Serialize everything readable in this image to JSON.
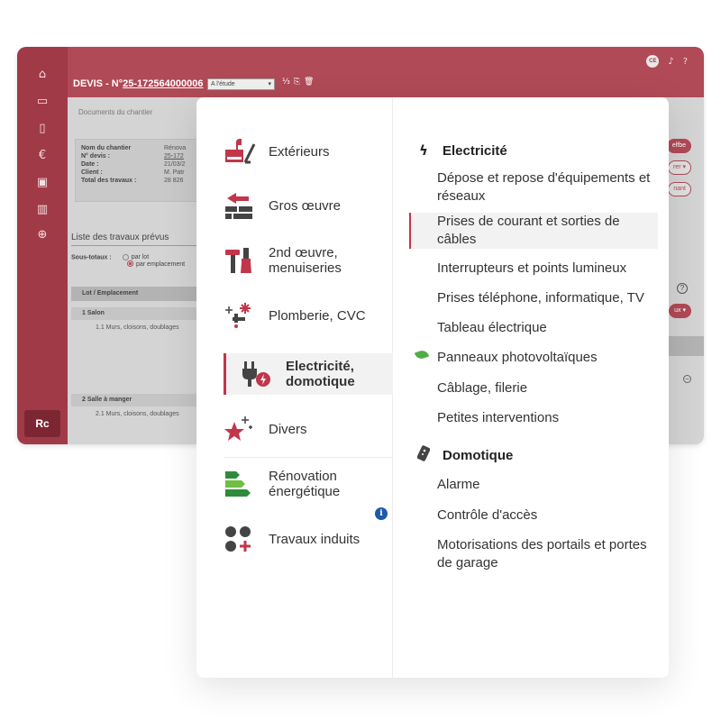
{
  "app": {
    "sidebar_icons": [
      "home-icon",
      "folder-open-icon",
      "file-icon",
      "euro-icon",
      "contact-card-icon",
      "library-icon",
      "globe-icon"
    ],
    "sidebar_bottom_logo": "Rc",
    "header": {
      "title_prefix": "DEVIS - N°",
      "quote_number": "25-172564000006",
      "status_select": "A l'étude",
      "avatar_initials": "CE"
    },
    "content": {
      "docs_tab": "Documents du chantier",
      "info": [
        {
          "key": "Nom du chantier",
          "value": "Rénova"
        },
        {
          "key": "N° devis :",
          "value": "25-172"
        },
        {
          "key": "Date :",
          "value": "21/03/2"
        },
        {
          "key": "Client :",
          "value": "M. Patr"
        },
        {
          "key": "Total des travaux :",
          "value": "28 826"
        }
      ],
      "list_title": "Liste des travaux prévus",
      "subtotals_label": "Sous-totaux :",
      "subtotal_options": [
        "par lot",
        "par emplacement"
      ],
      "table_header": "Lot / Emplacement",
      "groups": [
        {
          "label": "1   Salon",
          "sub": "1.1  Murs, cloisons, doublages"
        },
        {
          "label": "2   Salle à manger",
          "sub": "2.1  Murs, cloisons, doublages"
        }
      ],
      "right_pills": [
        "elfbe",
        "rer ▾",
        "nant",
        "ux ▾"
      ]
    }
  },
  "menu": {
    "categories": [
      {
        "label": "Extérieurs",
        "icon": "exterior-works-icon"
      },
      {
        "label": "Gros œuvre",
        "icon": "structural-works-icon"
      },
      {
        "label": "2nd œuvre, menuiseries",
        "icon": "carpentry-tools-icon"
      },
      {
        "label": "Plomberie, CVC",
        "icon": "plumbing-hvac-icon"
      },
      {
        "label": "Electricité, domotique",
        "icon": "electric-plug-icon"
      },
      {
        "label": "Divers",
        "icon": "misc-star-icon"
      },
      {
        "label": "Rénovation énergétique",
        "icon": "energy-label-icon"
      },
      {
        "label": "Travaux induits",
        "icon": "induced-works-icon"
      }
    ],
    "info_badge": "i",
    "sections": [
      {
        "title": "Electricité",
        "icon": "lightning-icon",
        "items": [
          "Dépose et repose d'équipements et réseaux",
          "Prises de courant et sorties de câbles",
          "Interrupteurs et points lumineux",
          "Prises téléphone, informatique, TV",
          "Tableau électrique",
          "Panneaux photovoltaïques",
          "Câblage, filerie",
          "Petites interventions"
        ]
      },
      {
        "title": "Domotique",
        "icon": "remote-control-icon",
        "items": [
          "Alarme",
          "Contrôle d'accès",
          "Motorisations des portails et portes de garage"
        ]
      }
    ]
  }
}
